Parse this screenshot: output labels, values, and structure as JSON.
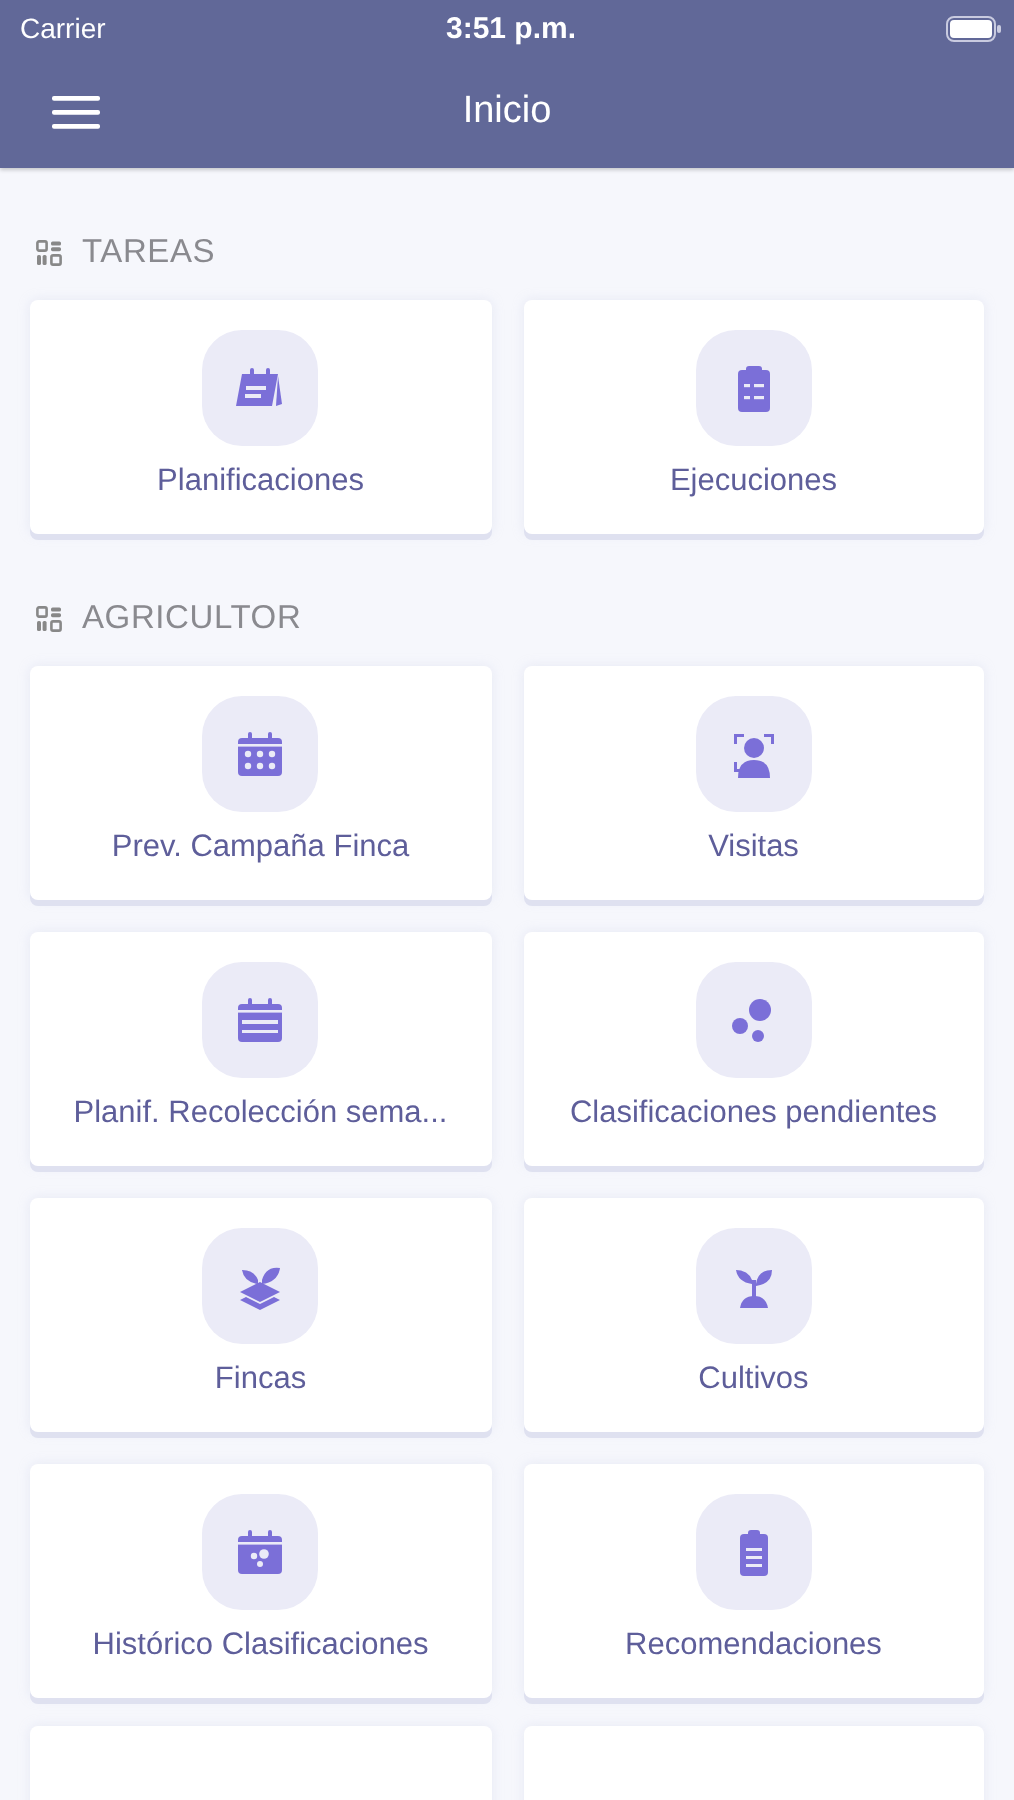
{
  "status_bar": {
    "carrier": "Carrier",
    "time": "3:51 p.m."
  },
  "nav_bar": {
    "title": "Inicio"
  },
  "sections": [
    {
      "title": "TAREAS",
      "tiles": [
        {
          "label": "Planificaciones",
          "kind": "calendar-edit"
        },
        {
          "label": "Ejecuciones",
          "kind": "clipboard-check"
        }
      ]
    },
    {
      "title": "AGRICULTOR",
      "tiles": [
        {
          "label": "Prev. Campaña Finca",
          "kind": "calendar-grid"
        },
        {
          "label": "Visitas",
          "kind": "face-scan"
        },
        {
          "label": "Planif. Recolección sema...",
          "kind": "calendar-rows"
        },
        {
          "label": "Clasificaciones pendientes",
          "kind": "dots"
        },
        {
          "label": "Fincas",
          "kind": "plant-layers"
        },
        {
          "label": "Cultivos",
          "kind": "plant"
        },
        {
          "label": "Histórico Clasificaciones",
          "kind": "calendar-dots"
        },
        {
          "label": "Recomendaciones",
          "kind": "clipboard-lines"
        }
      ]
    }
  ]
}
